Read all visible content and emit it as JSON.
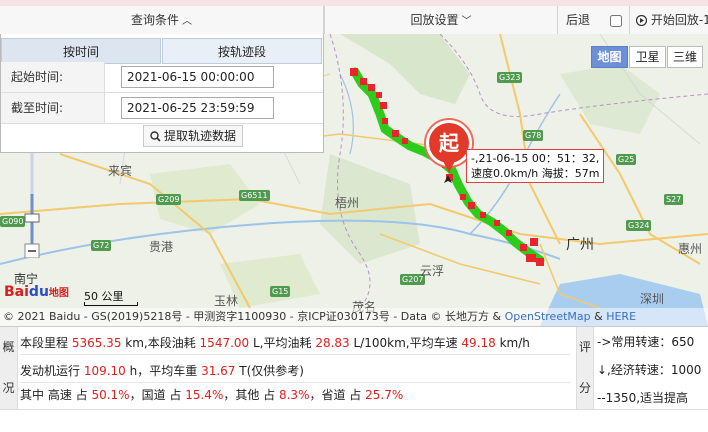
{
  "toolbar": {
    "query_label": "查询条件",
    "replay_label": "回放设置",
    "back_label": "后退",
    "play_label": "开始回放-1"
  },
  "query": {
    "tab_time": "按时间",
    "tab_track": "按轨迹段",
    "start_label": "起始时间:",
    "start_value": "2021-06-15 00:00:00",
    "end_label": "截至时间:",
    "end_value": "2021-06-25 23:59:59",
    "fetch_button": "提取轨迹数据"
  },
  "map_types": {
    "map": "地图",
    "satellite": "卫星",
    "three_d": "三维"
  },
  "map": {
    "start_marker": "起",
    "tooltip_line1": "-,21-06-15 00：51：32,",
    "tooltip_line2": "速度0.0km/h 海拔：57m",
    "cities": {
      "laibin": "来宾",
      "guigang": "贵港",
      "wuzhou": "梧州",
      "yunfu": "云浮",
      "guangzhou": "广州",
      "huizhou": "惠州",
      "yulin": "玉林",
      "maoming": "茂名",
      "shenzhen": "深圳",
      "nanning": "南宁"
    },
    "highways": {
      "g323": "G323",
      "g78": "G78",
      "g6511": "G6511",
      "g209": "G209",
      "g72": "G72",
      "g090": "G090",
      "g25": "G25",
      "s27": "S27",
      "g324": "G324",
      "g15": "G15",
      "g207": "G207"
    },
    "scale": "50 公里",
    "logo_bai": "Bai",
    "logo_du": "du",
    "logo_map": "地图",
    "copyright_main": "© 2021 Baidu - GS(2019)5218号 - 甲测资字1100930 - 京ICP证030173号 - Data © 长地万方 & ",
    "copyright_osm": "OpenStreetMap",
    "copyright_and": " & ",
    "copyright_here": "HERE"
  },
  "summary": {
    "left_label_1": "概",
    "left_label_2": "况",
    "line1": {
      "p1": "本段里程 ",
      "mileage": "5365.35",
      "p2": " km,本段油耗 ",
      "fuel": "1547.00",
      "p3": " L,平均油耗 ",
      "avg_fuel": "28.83",
      "p4": " L/100km,平均车速 ",
      "avg_speed": "49.18",
      "p5": " km/h"
    },
    "line2": {
      "p1": "发动机运行 ",
      "engine": "109.10",
      "p2": " h，平均车重 ",
      "weight": "31.67",
      "p3": " T(仅供参考)"
    },
    "line3": {
      "p1": "其中 高速 占 ",
      "highway": "50.1%",
      "p2": "，国道 占 ",
      "national": "15.4%",
      "p3": "，其他 占 ",
      "other": "8.3%",
      "p4": "，省道 占 ",
      "provincial": "25.7%"
    },
    "right_label_1": "评",
    "right_label_2": "分",
    "right_1": "->常用转速：650",
    "right_2": "↓,经济转速：1000",
    "right_3": "--1350,适当提高"
  },
  "colors": {
    "track": "#2ecc1a",
    "track_red": "#e8242c",
    "accent": "#6c8fd8"
  }
}
